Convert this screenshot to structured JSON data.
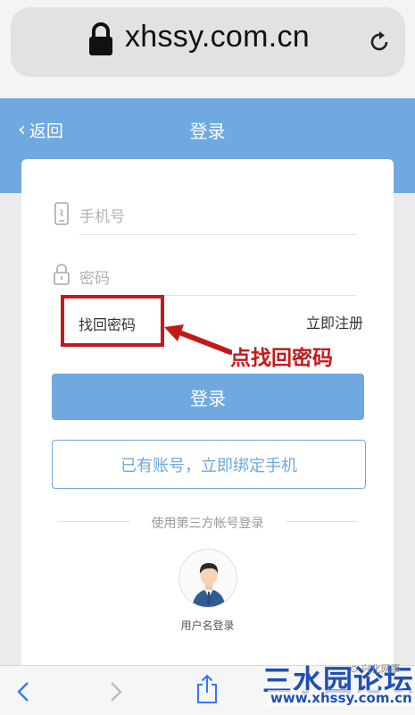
{
  "browser": {
    "url": "xhssy.com.cn",
    "lock_icon": "lock-icon",
    "reload_icon": "reload-icon"
  },
  "header": {
    "back_label": "返回",
    "title": "登录",
    "bg_color": "#6fa9e0"
  },
  "form": {
    "phone_placeholder": "手机号",
    "password_placeholder": "密码",
    "forgot_password": "找回密码",
    "register": "立即注册",
    "login_button": "登录",
    "bind_button": "已有账号，立即绑定手机"
  },
  "annotation": {
    "text": "点找回密码",
    "color": "#c21a1a"
  },
  "third_party": {
    "divider_text": "使用第三方帐号登录",
    "username_login": "用户名登录"
  },
  "watermark": {
    "logo": "三水园论坛",
    "url": "www.xhssy.com.cn",
    "corner": "⊙ 兴化网事"
  },
  "toolbar": {
    "icons": [
      "back-icon",
      "forward-icon",
      "share-icon"
    ]
  }
}
